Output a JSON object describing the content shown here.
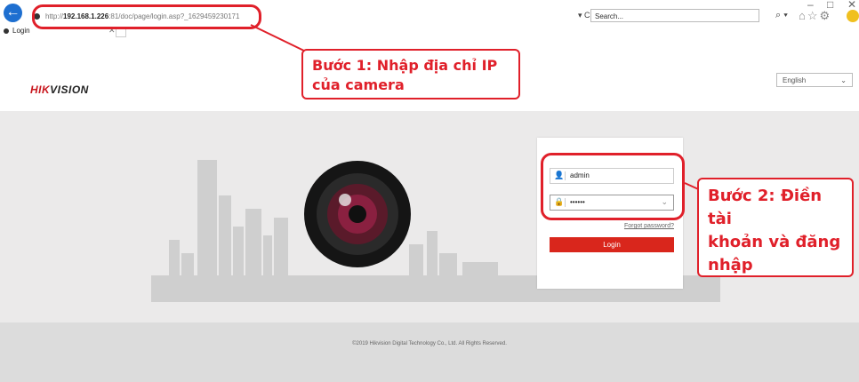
{
  "window": {
    "minimize": "–",
    "maximize": "□",
    "close": "✕"
  },
  "browser": {
    "url_prefix": "http://",
    "url_host": "192.168.1.226",
    "url_rest": ":81/doc/page/login.asp?_1629459230171",
    "refresh_label": "▾ C",
    "search_placeholder": "Search...",
    "search_tool_label": "⌕ ▾",
    "tab_title": "Login",
    "tab_close": "✕"
  },
  "page": {
    "brand_a": "HIK",
    "brand_b": "VISION",
    "language": "English",
    "username": "admin",
    "password": "••••••",
    "forgot_password": "Forgot password?",
    "login_button": "Login",
    "copyright": "©2019 Hikvision Digital Technology Co., Ltd. All Rights Reserved."
  },
  "annotations": {
    "step1_line1": "Bước 1: Nhập địa chỉ IP",
    "step1_line2": "của camera",
    "step2_line1": "Bước 2: Điền tài",
    "step2_line2": "khoản và đăng",
    "step2_line3": "nhập"
  },
  "colors": {
    "accent_red": "#e0202a",
    "login_red": "#d9261c",
    "browser_blue": "#1e6fd0"
  },
  "icons": [
    "back-arrow-icon",
    "home-icon",
    "star-icon",
    "gear-icon",
    "user-icon",
    "lock-icon",
    "chevron-down-icon"
  ]
}
